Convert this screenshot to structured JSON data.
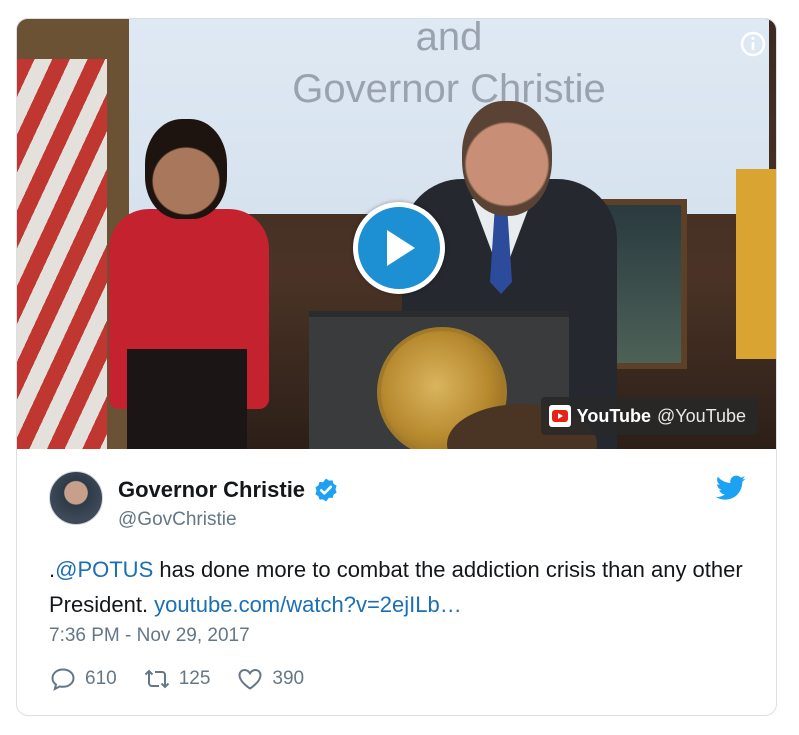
{
  "media": {
    "screen_line_1": "and",
    "screen_line_2": "Governor Christie",
    "play_icon": "play-icon",
    "info_icon": "info-icon",
    "provider_brand": "YouTube",
    "provider_handle": "@YouTube",
    "provider_icon": "youtube-icon"
  },
  "author": {
    "display_name": "Governor Christie",
    "handle": "@GovChristie",
    "verified_icon": "verified-badge-icon",
    "avatar_icon": "avatar"
  },
  "tweet": {
    "text_prefix": ".",
    "mention": "@POTUS",
    "text_body": " has done more to combat the addiction crisis than any other President. ",
    "link": "youtube.com/watch?v=2ejILb…",
    "timestamp": "7:36 PM - Nov 29, 2017"
  },
  "actions": {
    "replies": "610",
    "retweets": "125",
    "likes": "390"
  },
  "colors": {
    "accent": "#1DA1F2",
    "link": "#1B6FB5",
    "secondary_text": "#657786",
    "play_button": "#1D8FD3"
  }
}
